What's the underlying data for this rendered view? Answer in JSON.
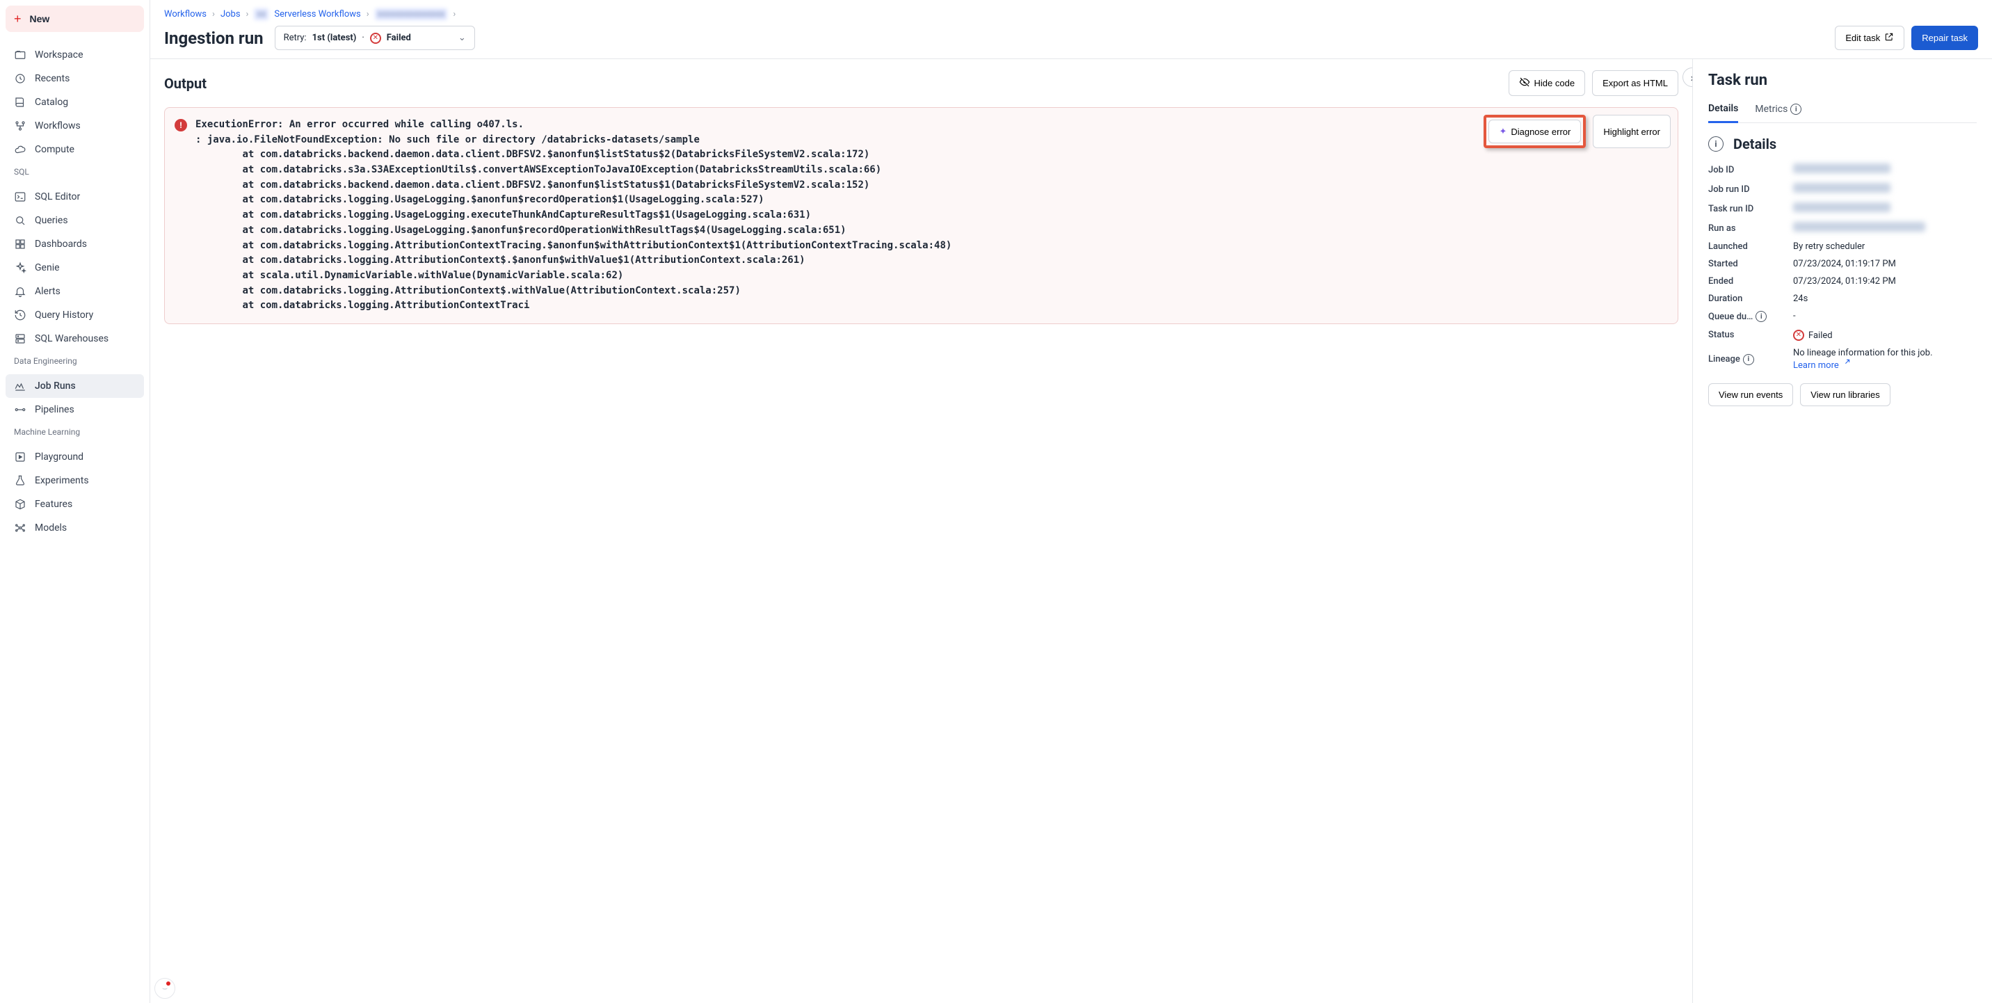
{
  "sidebar": {
    "new_label": "New",
    "primary": [
      {
        "label": "Workspace",
        "icon": "folder"
      },
      {
        "label": "Recents",
        "icon": "clock"
      },
      {
        "label": "Catalog",
        "icon": "book"
      },
      {
        "label": "Workflows",
        "icon": "flow"
      },
      {
        "label": "Compute",
        "icon": "cloud"
      }
    ],
    "sql_header": "SQL",
    "sql": [
      {
        "label": "SQL Editor",
        "icon": "terminal"
      },
      {
        "label": "Queries",
        "icon": "search"
      },
      {
        "label": "Dashboards",
        "icon": "grid"
      },
      {
        "label": "Genie",
        "icon": "sparkle"
      },
      {
        "label": "Alerts",
        "icon": "bell"
      },
      {
        "label": "Query History",
        "icon": "history"
      },
      {
        "label": "SQL Warehouses",
        "icon": "server"
      }
    ],
    "de_header": "Data Engineering",
    "de": [
      {
        "label": "Job Runs",
        "icon": "runs",
        "active": true
      },
      {
        "label": "Pipelines",
        "icon": "pipeline"
      }
    ],
    "ml_header": "Machine Learning",
    "ml": [
      {
        "label": "Playground",
        "icon": "play"
      },
      {
        "label": "Experiments",
        "icon": "flask"
      },
      {
        "label": "Features",
        "icon": "box"
      },
      {
        "label": "Models",
        "icon": "model"
      }
    ]
  },
  "breadcrumb": {
    "items": [
      "Workflows",
      "Jobs",
      "Serverless Workflows",
      "————"
    ]
  },
  "page_title": "Ingestion run",
  "retry": {
    "prefix": "Retry:",
    "value": "1st (latest)",
    "sep": "·",
    "status": "Failed"
  },
  "actions": {
    "edit": "Edit task",
    "repair": "Repair task"
  },
  "output": {
    "title": "Output",
    "hide_code": "Hide code",
    "export": "Export as HTML",
    "diagnose": "Diagnose error",
    "highlight": "Highlight error",
    "error_text": "ExecutionError: An error occurred while calling o407.ls.\n: java.io.FileNotFoundException: No such file or directory /databricks-datasets/sample\n        at com.databricks.backend.daemon.data.client.DBFSV2.$anonfun$listStatus$2(DatabricksFileSystemV2.scala:172)\n        at com.databricks.s3a.S3AExceptionUtils$.convertAWSExceptionToJavaIOException(DatabricksStreamUtils.scala:66)\n        at com.databricks.backend.daemon.data.client.DBFSV2.$anonfun$listStatus$1(DatabricksFileSystemV2.scala:152)\n        at com.databricks.logging.UsageLogging.$anonfun$recordOperation$1(UsageLogging.scala:527)\n        at com.databricks.logging.UsageLogging.executeThunkAndCaptureResultTags$1(UsageLogging.scala:631)\n        at com.databricks.logging.UsageLogging.$anonfun$recordOperationWithResultTags$4(UsageLogging.scala:651)\n        at com.databricks.logging.AttributionContextTracing.$anonfun$withAttributionContext$1(AttributionContextTracing.scala:48)\n        at com.databricks.logging.AttributionContext$.$anonfun$withValue$1(AttributionContext.scala:261)\n        at scala.util.DynamicVariable.withValue(DynamicVariable.scala:62)\n        at com.databricks.logging.AttributionContext$.withValue(AttributionContext.scala:257)\n        at com.databricks.logging.AttributionContextTraci"
  },
  "task_run": {
    "title": "Task run",
    "tabs": {
      "details": "Details",
      "metrics": "Metrics"
    },
    "details_header": "Details",
    "rows": {
      "job_id": {
        "label": "Job ID"
      },
      "job_run_id": {
        "label": "Job run ID"
      },
      "task_run_id": {
        "label": "Task run ID"
      },
      "run_as": {
        "label": "Run as"
      },
      "launched": {
        "label": "Launched",
        "value": "By retry scheduler"
      },
      "started": {
        "label": "Started",
        "value": "07/23/2024, 01:19:17 PM"
      },
      "ended": {
        "label": "Ended",
        "value": "07/23/2024, 01:19:42 PM"
      },
      "duration": {
        "label": "Duration",
        "value": "24s"
      },
      "queue": {
        "label": "Queue du…",
        "value": "-"
      },
      "status": {
        "label": "Status",
        "value": "Failed"
      },
      "lineage": {
        "label": "Lineage",
        "value": "No lineage information for this job.",
        "learn": "Learn more"
      }
    },
    "buttons": {
      "events": "View run events",
      "libraries": "View run libraries"
    }
  }
}
